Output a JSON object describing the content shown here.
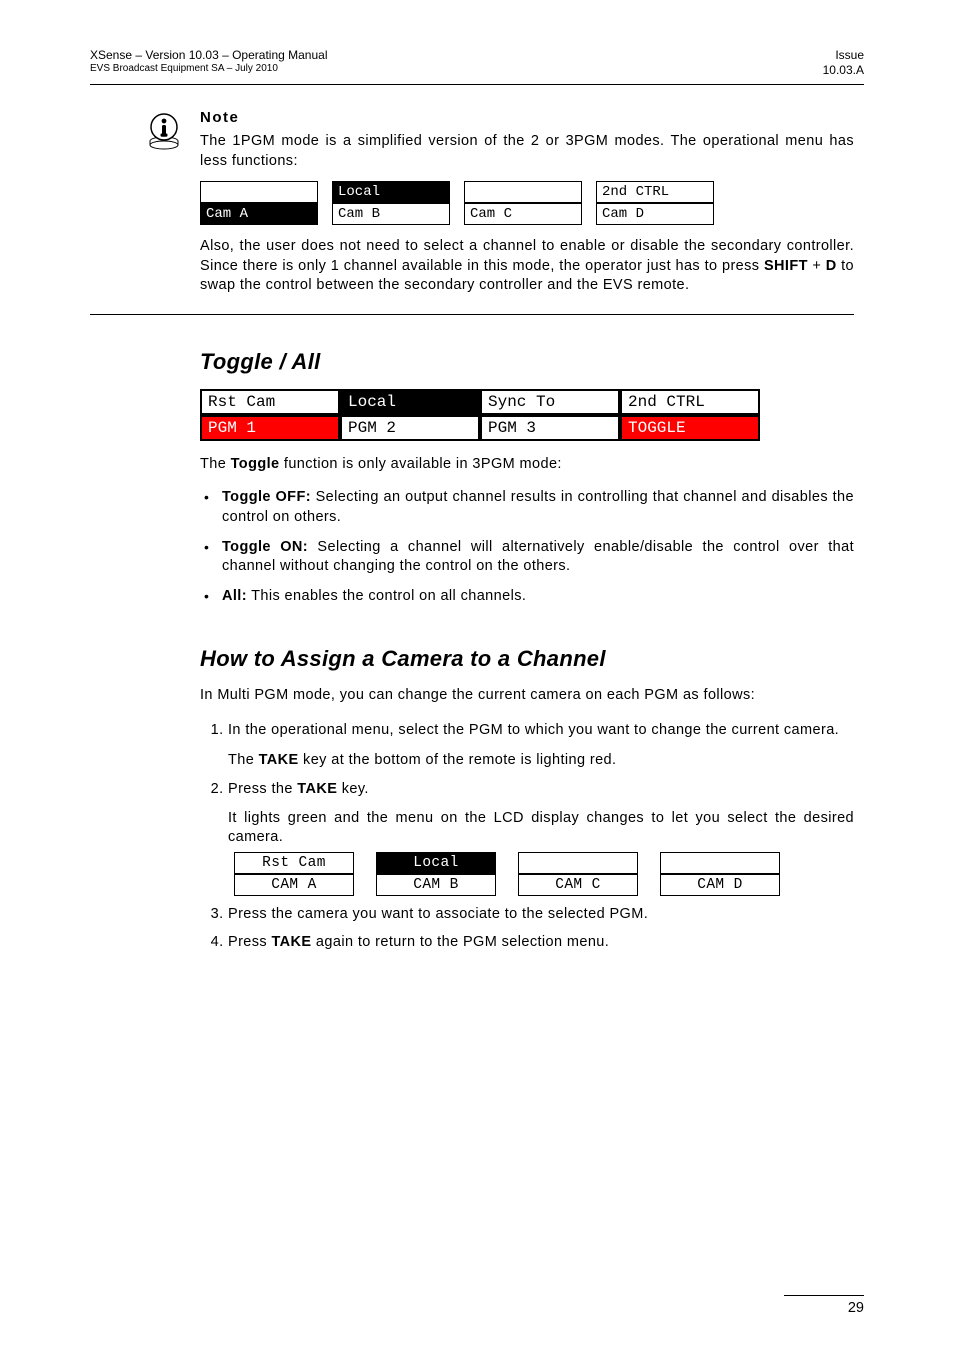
{
  "header": {
    "left_line1": "XSense – Version 10.03 – Operating Manual",
    "left_line2": "EVS Broadcast Equipment SA – July 2010",
    "right_line1": "Issue",
    "right_line2": "10.03.A"
  },
  "note": {
    "heading": "Note",
    "para1": "The 1PGM mode is a simplified version of the 2 or 3PGM modes. The operational menu has less functions:",
    "row": [
      {
        "top": "",
        "bot": "Cam A",
        "top_inv": false,
        "bot_inv": true
      },
      {
        "top": "Local",
        "bot": "Cam B",
        "top_inv": true,
        "bot_inv": false
      },
      {
        "top": "",
        "bot": "Cam C",
        "top_inv": false,
        "bot_inv": false
      },
      {
        "top": "2nd CTRL",
        "bot": "Cam D",
        "top_inv": false,
        "bot_inv": false
      }
    ],
    "para2a": "Also, the user does not need to select a channel to enable or disable the secondary controller. Since there is only 1 channel available in this mode, the operator just has to press ",
    "para2_key1": "SHIFT",
    "para2_plus": " + ",
    "para2_key2": "D",
    "para2b": " to swap the control between the secondary controller and the EVS remote."
  },
  "toggle": {
    "heading": "Toggle / All",
    "row_top": [
      "Rst Cam",
      "Local",
      "Sync To",
      "2nd CTRL"
    ],
    "row_bot": [
      "PGM 1",
      "PGM 2",
      "PGM 3",
      "TOGGLE"
    ],
    "top_inv": [
      false,
      true,
      false,
      false
    ],
    "bot_style": [
      "red",
      "plain",
      "plain",
      "red"
    ],
    "intro_a": "The ",
    "intro_b": "Toggle",
    "intro_c": " function is only available in 3PGM mode:",
    "bullets": [
      {
        "label": "Toggle OFF:",
        "text": " Selecting an output channel results in controlling that channel and disables the control on others."
      },
      {
        "label": "Toggle ON:",
        "text": " Selecting a channel will alternatively enable/disable the control over that channel without changing the control on the others."
      },
      {
        "label": "All:",
        "text": " This enables the control on all channels."
      }
    ]
  },
  "assign": {
    "heading": "How to Assign a Camera to a Channel",
    "intro": "In Multi PGM mode, you can change the current camera on each PGM as follows:",
    "step1": "In the operational menu, select the PGM to which you want to change the current camera.",
    "step1_sub_a": "The ",
    "step1_sub_key": "TAKE",
    "step1_sub_b": " key at the bottom of the remote is lighting red.",
    "step2_a": "Press the ",
    "step2_key": "TAKE",
    "step2_b": " key.",
    "step2_sub": "It lights green and the menu on the LCD display changes to let you select the desired camera.",
    "row_top": [
      "Rst Cam",
      "Local",
      "",
      ""
    ],
    "row_bot": [
      "CAM A",
      "CAM B",
      "CAM C",
      "CAM D"
    ],
    "top_inv": [
      false,
      true,
      false,
      false
    ],
    "step3": "Press the camera you want to associate to the selected PGM.",
    "step4_a": "Press ",
    "step4_key": "TAKE",
    "step4_b": " again to return to the PGM selection menu."
  },
  "footer": {
    "page": "29"
  }
}
